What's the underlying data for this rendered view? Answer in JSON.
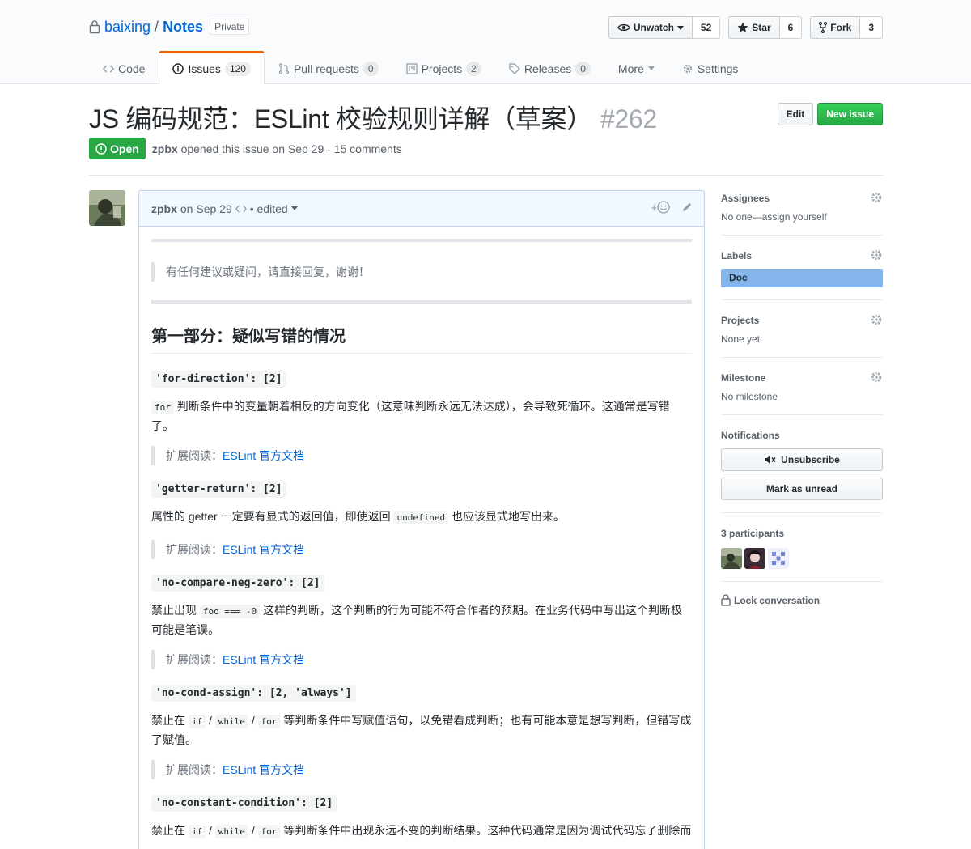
{
  "repo": {
    "owner": "baixing",
    "separator": "/",
    "name": "Notes",
    "visibility": "Private"
  },
  "actions": {
    "watch_label": "Unwatch",
    "watch_count": "52",
    "star_label": "Star",
    "star_count": "6",
    "fork_label": "Fork",
    "fork_count": "3"
  },
  "nav": {
    "code": "Code",
    "issues": "Issues",
    "issues_count": "120",
    "pulls": "Pull requests",
    "pulls_count": "0",
    "projects": "Projects",
    "projects_count": "2",
    "releases": "Releases",
    "releases_count": "0",
    "more": "More",
    "settings": "Settings"
  },
  "issue": {
    "title": "JS 编码规范：ESLint 校验规则详解（草案）",
    "number": "#262",
    "edit_label": "Edit",
    "new_issue_label": "New issue",
    "state": "Open",
    "author": "zpbx",
    "meta": "opened this issue on Sep 29 · 15 comments"
  },
  "comment": {
    "author": "zpbx",
    "date": "on Sep 29",
    "edited": "• edited",
    "reaction_plus": "+",
    "intro_quote": "有任何建议或疑问，请直接回复，谢谢！",
    "section_title": "第一部分：疑似写错的情况",
    "ext_prefix": "扩展阅读：",
    "ext_link": "ESLint 官方文档",
    "rules": [
      {
        "code": "'for-direction': [2]",
        "pre": "",
        "inline": "for",
        "post": " 判断条件中的变量朝着相反的方向变化（这意味判断永远无法达成），会导致死循环。这通常是写错了。"
      },
      {
        "code": "'getter-return': [2]",
        "pre": "属性的 getter 一定要有显式的返回值，即使返回 ",
        "inline": "undefined",
        "post": " 也应该显式地写出来。"
      },
      {
        "code": "'no-compare-neg-zero': [2]",
        "pre": "禁止出现 ",
        "inline": "foo === -0",
        "post": " 这样的判断，这个判断的行为可能不符合作者的预期。在业务代码中写出这个判断极可能是笔误。"
      },
      {
        "code": "'no-cond-assign': [2, 'always']",
        "pre": "禁止在 ",
        "inline": "if",
        "sep1": " / ",
        "inline2": "while",
        "sep2": " / ",
        "inline3": "for",
        "post": " 等判断条件中写赋值语句，以免错看成判断；也有可能本意是想写判断，但错写成了赋值。"
      },
      {
        "code": "'no-constant-condition': [2]",
        "pre": "禁止在 ",
        "inline": "if",
        "sep1": " / ",
        "inline2": "while",
        "sep2": " / ",
        "inline3": "for",
        "post": " 等判断条件中出现永远不变的判断结果。这种代码通常是因为调试代码忘了删除而"
      }
    ]
  },
  "sidebar": {
    "assignees_heading": "Assignees",
    "assignees_value": "No one—assign yourself",
    "labels_heading": "Labels",
    "label_doc": "Doc",
    "label_doc_color": "#84b6eb",
    "projects_heading": "Projects",
    "projects_value": "None yet",
    "milestone_heading": "Milestone",
    "milestone_value": "No milestone",
    "notifications_heading": "Notifications",
    "unsubscribe_label": "Unsubscribe",
    "mark_unread_label": "Mark as unread",
    "participants_heading": "3 participants",
    "lock_label": "Lock conversation"
  },
  "colors": {
    "accent": "#0366d6",
    "open_green": "#28a745",
    "nav_selected": "#e36209"
  }
}
